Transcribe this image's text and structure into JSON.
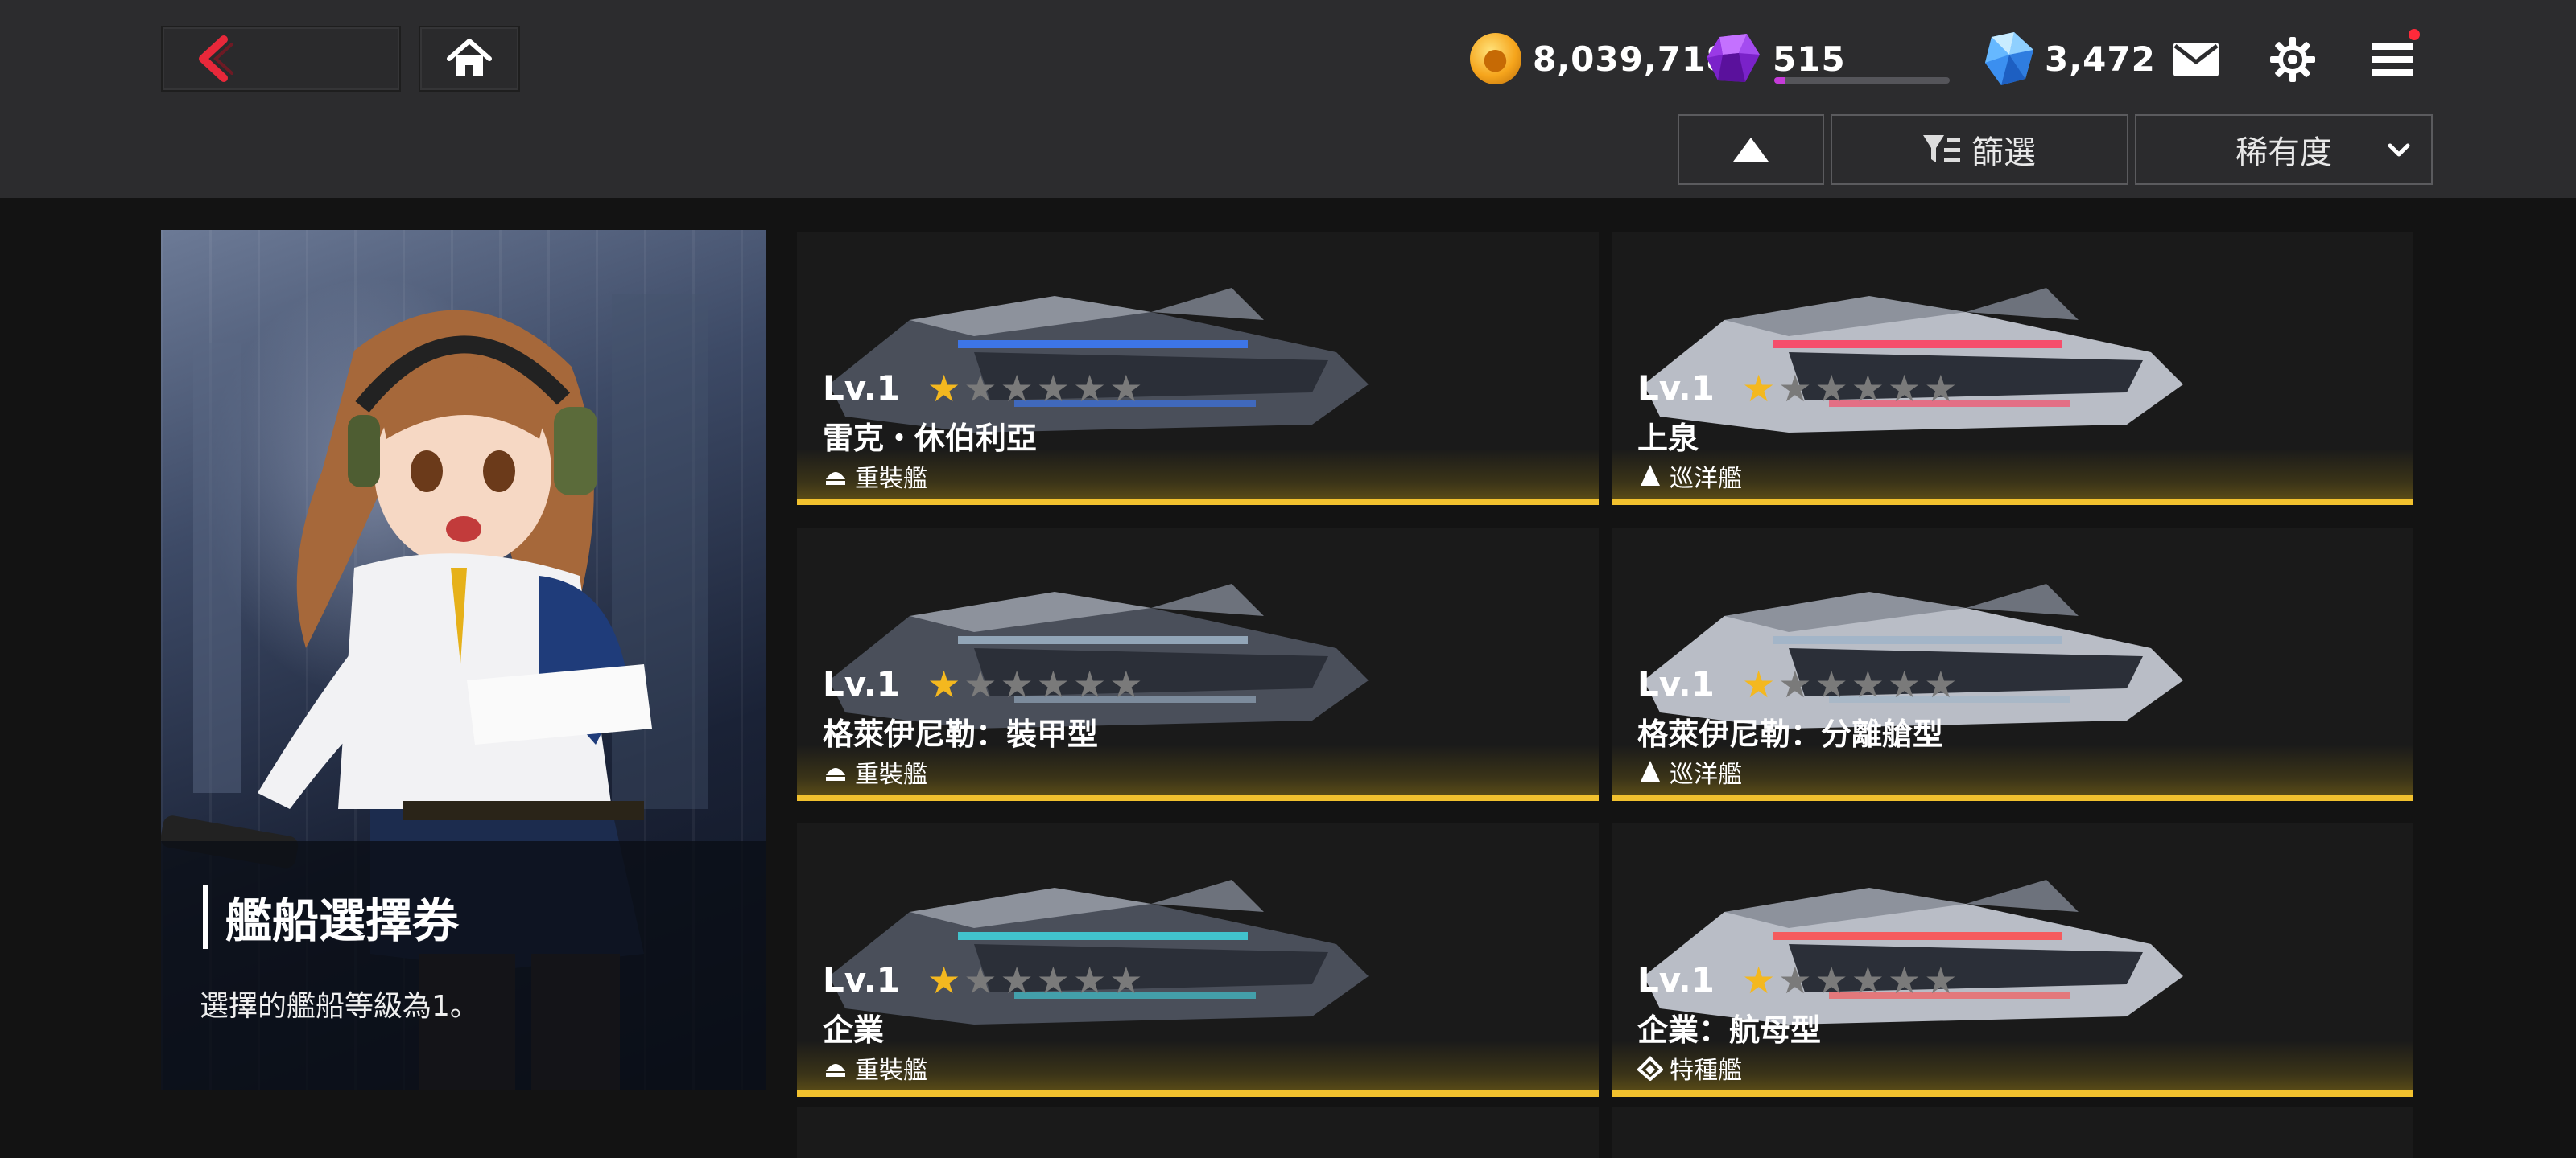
{
  "header": {
    "back_icon": "back-chevron-icon",
    "home_icon": "home-icon"
  },
  "currencies": [
    {
      "name": "gold",
      "icon": "gold-coin-icon",
      "value": "8,039,718"
    },
    {
      "name": "energy",
      "icon": "purple-gem-icon",
      "value": "515",
      "progress_fraction": 0.06
    },
    {
      "name": "crystal",
      "icon": "blue-crystal-icon",
      "value": "3,472"
    }
  ],
  "toolbar": {
    "mail_icon": "mail-icon",
    "settings_icon": "gear-icon",
    "menu_icon": "menu-icon",
    "sort_dir_icon": "triangle-up-icon",
    "filter_label": "篩選",
    "sort_label": "稀有度"
  },
  "ticket": {
    "title": "艦船選擇券",
    "description": "選擇的艦船等級為1。"
  },
  "ships": [
    {
      "level": "Lv.1",
      "stars_filled": 1,
      "stars_total": 6,
      "name": "雷克・休伯利亞",
      "type": "重裝艦",
      "accent": "#3b7bff"
    },
    {
      "level": "Lv.1",
      "stars_filled": 1,
      "stars_total": 6,
      "name": "上泉",
      "type": "巡洋艦",
      "accent": "#ff3b5a"
    },
    {
      "level": "Lv.1",
      "stars_filled": 1,
      "stars_total": 6,
      "name": "格萊伊尼勒：裝甲型",
      "type": "重裝艦",
      "accent": "#9fb4c8"
    },
    {
      "level": "Lv.1",
      "stars_filled": 1,
      "stars_total": 6,
      "name": "格萊伊尼勒：分離艙型",
      "type": "巡洋艦",
      "accent": "#9fb4c8"
    },
    {
      "level": "Lv.1",
      "stars_filled": 1,
      "stars_total": 6,
      "name": "企業",
      "type": "重裝艦",
      "accent": "#3fd6e0"
    },
    {
      "level": "Lv.1",
      "stars_filled": 1,
      "stars_total": 6,
      "name": "企業：航母型",
      "type": "特種艦",
      "accent": "#ff4a4a"
    }
  ],
  "colors": {
    "accent_yellow": "#f2c12e",
    "back_red": "#e8283a",
    "star_gold": "#f4b81f",
    "star_empty": "#7a7a7a"
  }
}
